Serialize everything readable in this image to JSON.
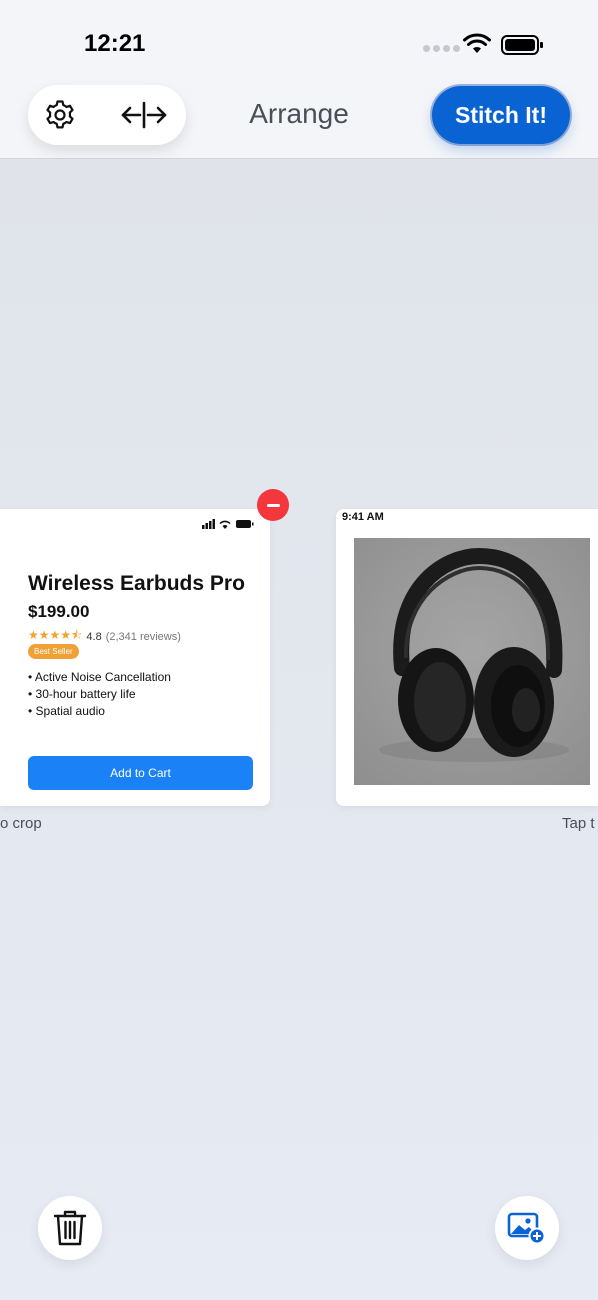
{
  "status_bar": {
    "time": "12:21"
  },
  "navbar": {
    "title": "Arrange",
    "stitch_label": "Stitch It!"
  },
  "card1": {
    "title": "Wireless Earbuds Pro",
    "price": "$199.00",
    "rating": "4.8",
    "reviews": "(2,341 reviews)",
    "rating_value": 4.5,
    "badge": "Best Seller",
    "features": [
      "• Active Noise Cancellation",
      "• 30-hour battery life",
      "• Spatial audio"
    ],
    "button_label": "Add to Cart"
  },
  "card2": {
    "time": "9:41 AM"
  },
  "hints": {
    "left": "o crop",
    "right": "Tap t"
  },
  "colors": {
    "accent": "#0a63d2",
    "remove": "#f4363d",
    "star": "#f2a22d",
    "badge": "#f0a035",
    "cart": "#1a82f6"
  },
  "icons": [
    "gear-icon",
    "split-arrows-icon",
    "minus-icon",
    "trash-icon",
    "add-photo-icon"
  ]
}
